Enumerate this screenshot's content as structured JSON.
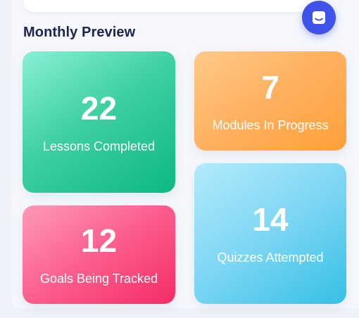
{
  "section": {
    "title": "Monthly Preview"
  },
  "fab": {
    "icon": "chat-icon",
    "color": "#3f53ea"
  },
  "stats": [
    {
      "value": "22",
      "label": "Lessons Completed",
      "color": "#20c493"
    },
    {
      "value": "7",
      "label": "Modules In Progress",
      "color": "#ffac4f"
    },
    {
      "value": "12",
      "label": "Goals Being Tracked",
      "color": "#fb4f7e"
    },
    {
      "value": "14",
      "label": "Quizzes Attempted",
      "color": "#63cdef"
    }
  ]
}
